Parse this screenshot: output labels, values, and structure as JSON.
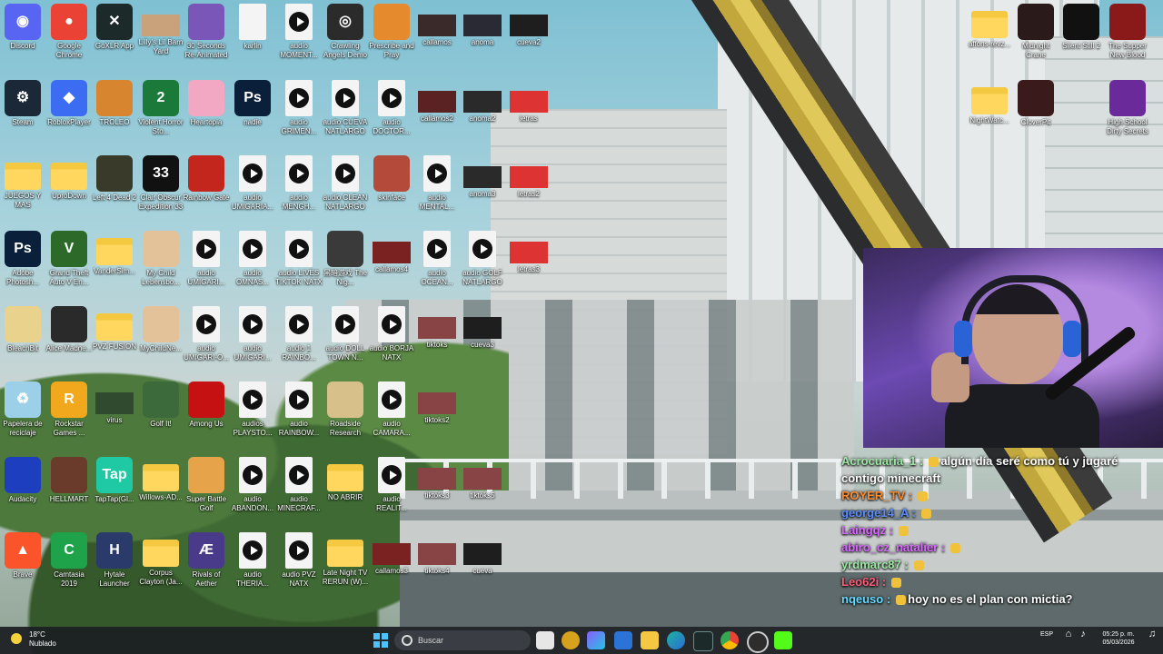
{
  "desktop_icons": [
    {
      "label": "Discord",
      "kind": "app",
      "color": "#5865f2",
      "glyph": "◉"
    },
    {
      "label": "Google Chrome",
      "kind": "app",
      "color": "#ea4335",
      "glyph": "●"
    },
    {
      "label": "GoXLR App",
      "kind": "app",
      "color": "#1c2a2a",
      "glyph": "✕"
    },
    {
      "label": "Lilly's Lil Barn Yard",
      "kind": "thumb",
      "color": "#c9a27b",
      "glyph": ""
    },
    {
      "label": "30 Seconds Re-Animated",
      "kind": "app",
      "color": "#7a56b8",
      "glyph": ""
    },
    {
      "label": "karlin",
      "kind": "doc",
      "color": "#f4f4f4",
      "glyph": ""
    },
    {
      "label": "audio MOMENT...",
      "kind": "play",
      "color": "#f4f4f4",
      "glyph": ""
    },
    {
      "label": "Crawling Angels Demo",
      "kind": "app",
      "color": "#2b2b2b",
      "glyph": "◎"
    },
    {
      "label": "Prescribe and Pray",
      "kind": "app",
      "color": "#e68a2e",
      "glyph": ""
    },
    {
      "label": "callamos",
      "kind": "thumb",
      "color": "#3a2a2a",
      "glyph": ""
    },
    {
      "label": "anoma",
      "kind": "thumb",
      "color": "#2a2a35",
      "glyph": ""
    },
    {
      "label": "cueva2",
      "kind": "thumb",
      "color": "#1e1e1e",
      "glyph": ""
    },
    {
      "label": "Steam",
      "kind": "app",
      "color": "#1b2838",
      "glyph": "⚙"
    },
    {
      "label": "RobloxPlayer",
      "kind": "app",
      "color": "#3b6cf2",
      "glyph": "◆"
    },
    {
      "label": "TROLEO",
      "kind": "app",
      "color": "#d7862f",
      "glyph": ""
    },
    {
      "label": "Violent Horror Sto...",
      "kind": "app",
      "color": "#1b7a3a",
      "glyph": "2"
    },
    {
      "label": "Heartopia",
      "kind": "app",
      "color": "#f2a7c3",
      "glyph": ""
    },
    {
      "label": "nadie",
      "kind": "app",
      "color": "#0a1f3a",
      "glyph": "Ps"
    },
    {
      "label": "audio GRIMEN...",
      "kind": "play",
      "color": "#f4f4f4",
      "glyph": ""
    },
    {
      "label": "audio CUEVA NATLARGO",
      "kind": "play",
      "color": "#f4f4f4",
      "glyph": ""
    },
    {
      "label": "audio DOCTOR...",
      "kind": "play",
      "color": "#f4f4f4",
      "glyph": ""
    },
    {
      "label": "callamos2",
      "kind": "thumb",
      "color": "#5a2222",
      "glyph": ""
    },
    {
      "label": "anoma2",
      "kind": "thumb",
      "color": "#2a2a2a",
      "glyph": ""
    },
    {
      "label": "letras",
      "kind": "thumb",
      "color": "#d33",
      "glyph": ""
    },
    {
      "label": "JUEGOS Y MAS",
      "kind": "folder",
      "color": "#f5c842",
      "glyph": ""
    },
    {
      "label": "UproDown",
      "kind": "folder",
      "color": "#f5c842",
      "glyph": ""
    },
    {
      "label": "Left 4 Dead 2",
      "kind": "app",
      "color": "#3a3a2a",
      "glyph": ""
    },
    {
      "label": "Clair Obscur Expedition 33",
      "kind": "app",
      "color": "#111",
      "glyph": "33"
    },
    {
      "label": "Rainbow Gate",
      "kind": "app",
      "color": "#c2261c",
      "glyph": ""
    },
    {
      "label": "audio UMIGARIA...",
      "kind": "play",
      "color": "#f4f4f4",
      "glyph": ""
    },
    {
      "label": "audio MENGH...",
      "kind": "play",
      "color": "#f4f4f4",
      "glyph": ""
    },
    {
      "label": "audio CLEAN NATLARGO",
      "kind": "play",
      "color": "#f4f4f4",
      "glyph": ""
    },
    {
      "label": "skinface",
      "kind": "app",
      "color": "#b44a3a",
      "glyph": ""
    },
    {
      "label": "audio MENTAL...",
      "kind": "play",
      "color": "#f4f4f4",
      "glyph": ""
    },
    {
      "label": "anoma3",
      "kind": "thumb",
      "color": "#2a2a2a",
      "glyph": ""
    },
    {
      "label": "letras2",
      "kind": "thumb",
      "color": "#d33",
      "glyph": ""
    },
    {
      "label": "Adobe Photosh...",
      "kind": "app",
      "color": "#0a1f3a",
      "glyph": "Ps"
    },
    {
      "label": "Grand Theft Auto V En...",
      "kind": "app",
      "color": "#2d6a2a",
      "glyph": "V"
    },
    {
      "label": "VanderSim...",
      "kind": "folder",
      "color": "#f5c842",
      "glyph": ""
    },
    {
      "label": "My Child Lebensbo...",
      "kind": "app",
      "color": "#e3c29a",
      "glyph": ""
    },
    {
      "label": "audio UMIGARI...",
      "kind": "play",
      "color": "#f4f4f4",
      "glyph": ""
    },
    {
      "label": "audio OMNAS...",
      "kind": "play",
      "color": "#f4f4f4",
      "glyph": ""
    },
    {
      "label": "audio LIVES TIKTOK NATX",
      "kind": "play",
      "color": "#f4f4f4",
      "glyph": ""
    },
    {
      "label": "黑暗游戏 The Nig...",
      "kind": "app",
      "color": "#3a3a3a",
      "glyph": ""
    },
    {
      "label": "callamos4",
      "kind": "thumb",
      "color": "#7a2222",
      "glyph": ""
    },
    {
      "label": "audio OCEAN...",
      "kind": "play",
      "color": "#f4f4f4",
      "glyph": ""
    },
    {
      "label": "audio GOLF NATLARGO",
      "kind": "play",
      "color": "#f4f4f4",
      "glyph": ""
    },
    {
      "label": "letras3",
      "kind": "thumb",
      "color": "#d33",
      "glyph": ""
    },
    {
      "label": "BleachBit",
      "kind": "app",
      "color": "#e9d38c",
      "glyph": ""
    },
    {
      "label": "Alice Madne...",
      "kind": "app",
      "color": "#2a2a2a",
      "glyph": ""
    },
    {
      "label": "PVZ FUSION",
      "kind": "folder",
      "color": "#f5c842",
      "glyph": ""
    },
    {
      "label": "MyChildNe...",
      "kind": "app",
      "color": "#e3c29a",
      "glyph": ""
    },
    {
      "label": "audio UMIGARI-O...",
      "kind": "play",
      "color": "#f4f4f4",
      "glyph": ""
    },
    {
      "label": "audio UMIGARI...",
      "kind": "play",
      "color": "#f4f4f4",
      "glyph": ""
    },
    {
      "label": "audio 1 RAINBO...",
      "kind": "play",
      "color": "#f4f4f4",
      "glyph": ""
    },
    {
      "label": "audio DOLL TOWN N...",
      "kind": "play",
      "color": "#f4f4f4",
      "glyph": ""
    },
    {
      "label": "audio BORJA NATX",
      "kind": "play",
      "color": "#f4f4f4",
      "glyph": ""
    },
    {
      "label": "tiktoks",
      "kind": "thumb",
      "color": "#884444",
      "glyph": ""
    },
    {
      "label": "cueva3",
      "kind": "thumb",
      "color": "#1e1e1e",
      "glyph": ""
    },
    {
      "label": "Papelera de reciclaje",
      "kind": "app",
      "color": "#9bd0e8",
      "glyph": "♻"
    },
    {
      "label": "Rockstar Games ...",
      "kind": "app",
      "color": "#f2a81c",
      "glyph": "R"
    },
    {
      "label": "virus",
      "kind": "thumb",
      "color": "#2f4a2f",
      "glyph": ""
    },
    {
      "label": "Golf It!",
      "kind": "app",
      "color": "#3d6a3a",
      "glyph": ""
    },
    {
      "label": "Among Us",
      "kind": "app",
      "color": "#c51111",
      "glyph": ""
    },
    {
      "label": "audios PLAYSTO...",
      "kind": "play",
      "color": "#f4f4f4",
      "glyph": ""
    },
    {
      "label": "audio RAINBOW...",
      "kind": "play",
      "color": "#f4f4f4",
      "glyph": ""
    },
    {
      "label": "Roadside Research",
      "kind": "app",
      "color": "#d8c08a",
      "glyph": ""
    },
    {
      "label": "audio CAMARA...",
      "kind": "play",
      "color": "#f4f4f4",
      "glyph": ""
    },
    {
      "label": "tiktoks2",
      "kind": "thumb",
      "color": "#884444",
      "glyph": ""
    },
    {
      "label": "Audacity",
      "kind": "app",
      "color": "#1d3fbf",
      "glyph": ""
    },
    {
      "label": "HELLMART",
      "kind": "app",
      "color": "#6a3a2a",
      "glyph": ""
    },
    {
      "label": "TapTap(Gl...",
      "kind": "app",
      "color": "#1ec9a3",
      "glyph": "Tap"
    },
    {
      "label": "Willows-AD...",
      "kind": "folder",
      "color": "#f5c842",
      "glyph": ""
    },
    {
      "label": "Super Battle Golf",
      "kind": "app",
      "color": "#e6a34a",
      "glyph": ""
    },
    {
      "label": "audio ABANDON...",
      "kind": "play",
      "color": "#f4f4f4",
      "glyph": ""
    },
    {
      "label": "audio MINECRAF...",
      "kind": "play",
      "color": "#f4f4f4",
      "glyph": ""
    },
    {
      "label": "NO ABRIR",
      "kind": "folder",
      "color": "#f5c842",
      "glyph": ""
    },
    {
      "label": "audio REALIT...",
      "kind": "play",
      "color": "#f4f4f4",
      "glyph": ""
    },
    {
      "label": "tiktoks3",
      "kind": "thumb",
      "color": "#884444",
      "glyph": ""
    },
    {
      "label": "tiktoks5",
      "kind": "thumb",
      "color": "#884444",
      "glyph": ""
    },
    {
      "label": "Brave",
      "kind": "app",
      "color": "#fb542b",
      "glyph": "▲"
    },
    {
      "label": "Camtasia 2019",
      "kind": "app",
      "color": "#1fa34a",
      "glyph": "C"
    },
    {
      "label": "Hytale Launcher",
      "kind": "app",
      "color": "#2a3a6a",
      "glyph": "H"
    },
    {
      "label": "Corpus Clayton (Ja...",
      "kind": "folder",
      "color": "#f5c842",
      "glyph": ""
    },
    {
      "label": "Rivals of Aether",
      "kind": "app",
      "color": "#4a3a8a",
      "glyph": "Æ"
    },
    {
      "label": "audio THERIA...",
      "kind": "play",
      "color": "#f4f4f4",
      "glyph": ""
    },
    {
      "label": "audio PVZ NATX",
      "kind": "play",
      "color": "#f4f4f4",
      "glyph": ""
    },
    {
      "label": "Late Night TV RERUN (W)...",
      "kind": "folder",
      "color": "#f5c842",
      "glyph": ""
    },
    {
      "label": "callamos3",
      "kind": "thumb",
      "color": "#7a2222",
      "glyph": ""
    },
    {
      "label": "tiktoks4",
      "kind": "thumb",
      "color": "#884444",
      "glyph": ""
    },
    {
      "label": "cueva",
      "kind": "thumb",
      "color": "#1e1e1e",
      "glyph": ""
    },
    {
      "label": "affons-revz...",
      "kind": "folder",
      "color": "#f5c842",
      "glyph": ""
    },
    {
      "label": "Midnight Crane",
      "kind": "app",
      "color": "#2a1a1a",
      "glyph": ""
    },
    {
      "label": "Silent Still 2",
      "kind": "app",
      "color": "#111",
      "glyph": ""
    },
    {
      "label": "The Supper New Blood",
      "kind": "app",
      "color": "#8a1a1a",
      "glyph": ""
    },
    {
      "label": "NightWatc...",
      "kind": "folder",
      "color": "#f5c842",
      "glyph": ""
    },
    {
      "label": "CloverPit",
      "kind": "app",
      "color": "#3a1a1a",
      "glyph": ""
    },
    {
      "label": "High School Dirty Secrets",
      "kind": "app",
      "color": "#6a2a9a",
      "glyph": ""
    }
  ],
  "chat": [
    {
      "user": "Acrocuaria_1",
      "user_color": "#9be7a3",
      "message": "algún día seré como tú y jugaré contigo minecraft"
    },
    {
      "user": "ROYER_TV",
      "user_color": "#ff8a2a",
      "message": ""
    },
    {
      "user": "george14_A",
      "user_color": "#5b8cff",
      "message": ""
    },
    {
      "user": "Laingqz",
      "user_color": "#d966ff",
      "message": ""
    },
    {
      "user": "abiro_cz_natalier",
      "user_color": "#d966ff",
      "message": ""
    },
    {
      "user": "yrdmarc87",
      "user_color": "#9be7a3",
      "message": ""
    },
    {
      "user": "Leo62i",
      "user_color": "#ff5c7a",
      "message": ""
    },
    {
      "user": "nqeuso",
      "user_color": "#66d9ff",
      "message": "hoy no es el plan con mictia?"
    }
  ],
  "taskbar": {
    "weather_temp": "18°C",
    "weather_desc": "Nublado",
    "search_placeholder": "Buscar",
    "lang": "ESP",
    "time": "05:25 p. m.",
    "date": "05/03/2026"
  }
}
